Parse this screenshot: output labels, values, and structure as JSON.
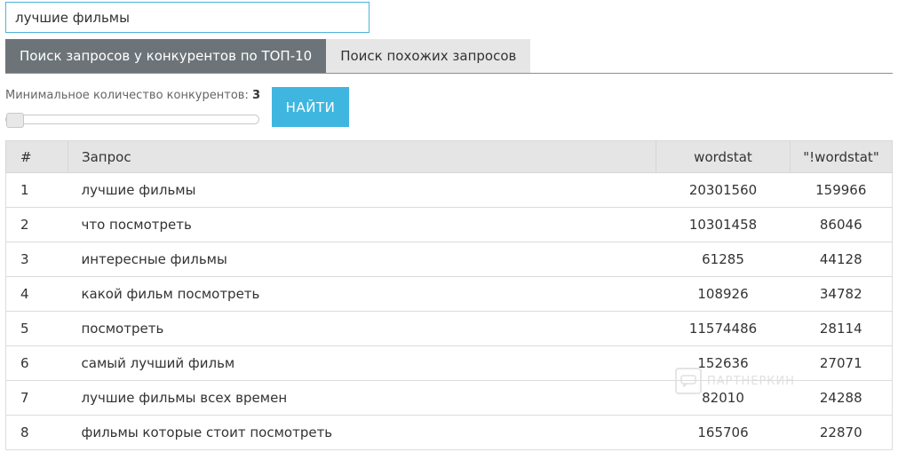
{
  "search": {
    "value": "лучшие фильмы"
  },
  "tabs": [
    {
      "label": "Поиск запросов у конкурентов по ТОП-10",
      "active": true
    },
    {
      "label": "Поиск похожих запросов",
      "active": false
    }
  ],
  "filter": {
    "min_label": "Минимальное количество конкурентов:",
    "min_value": "3"
  },
  "find_button": "НАЙТИ",
  "table": {
    "headers": {
      "num": "#",
      "query": "Запрос",
      "wordstat": "wordstat",
      "exact_wordstat": "\"!wordstat\""
    },
    "rows": [
      {
        "num": "1",
        "query": "лучшие фильмы",
        "wordstat": "20301560",
        "exact_wordstat": "159966"
      },
      {
        "num": "2",
        "query": "что посмотреть",
        "wordstat": "10301458",
        "exact_wordstat": "86046"
      },
      {
        "num": "3",
        "query": "интересные фильмы",
        "wordstat": "61285",
        "exact_wordstat": "44128"
      },
      {
        "num": "4",
        "query": "какой фильм посмотреть",
        "wordstat": "108926",
        "exact_wordstat": "34782"
      },
      {
        "num": "5",
        "query": "посмотреть",
        "wordstat": "11574486",
        "exact_wordstat": "28114"
      },
      {
        "num": "6",
        "query": "самый лучший фильм",
        "wordstat": "152636",
        "exact_wordstat": "27071"
      },
      {
        "num": "7",
        "query": "лучшие фильмы всех времен",
        "wordstat": "82010",
        "exact_wordstat": "24288"
      },
      {
        "num": "8",
        "query": "фильмы которые стоит посмотреть",
        "wordstat": "165706",
        "exact_wordstat": "22870"
      }
    ]
  },
  "watermark": {
    "text": "ПАРТНЕРКИН",
    "icon": "chat-logo-icon"
  },
  "colors": {
    "accent": "#3fb6e0",
    "tab_active": "#6d7479",
    "tab_inactive": "#e6e6e6",
    "header_bg": "#e5e5e5"
  }
}
